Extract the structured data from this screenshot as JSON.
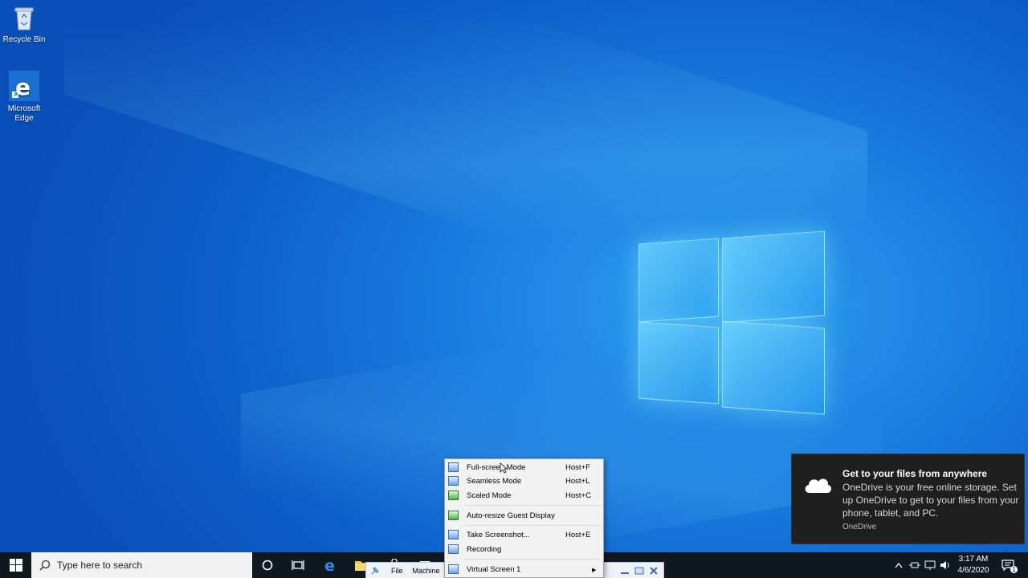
{
  "desktop": {
    "icons": [
      {
        "label": "Recycle Bin",
        "icon": "recycle-bin-icon"
      },
      {
        "label": "Microsoft Edge",
        "icon": "edge-icon"
      }
    ]
  },
  "taskbar": {
    "search_placeholder": "Type here to search",
    "clock_time": "3:17 AM",
    "clock_date": "4/6/2020",
    "notification_count": "1"
  },
  "minibar": {
    "file_label": "File",
    "machine_label": "Machine"
  },
  "context_menu": {
    "items": [
      {
        "label": "Full-screen Mode",
        "shortcut": "Host+F",
        "icon": "fullscreen-icon"
      },
      {
        "label": "Seamless Mode",
        "shortcut": "Host+L",
        "icon": "seamless-icon"
      },
      {
        "label": "Scaled Mode",
        "shortcut": "Host+C",
        "icon": "scaled-icon"
      },
      {
        "label": "Auto-resize Guest Display",
        "shortcut": "",
        "icon": "auto-resize-icon"
      },
      {
        "label": "Take Screenshot...",
        "shortcut": "Host+E",
        "icon": "screenshot-icon"
      },
      {
        "label": "Recording",
        "shortcut": "",
        "icon": "recording-icon"
      },
      {
        "label": "Virtual Screen 1",
        "shortcut": "",
        "icon": "virtual-screen-icon"
      }
    ]
  },
  "notification": {
    "title": "Get to your files from anywhere",
    "body": "OneDrive is your free online storage. Set up OneDrive to get to your files from your phone, tablet, and PC.",
    "source": "OneDrive"
  }
}
